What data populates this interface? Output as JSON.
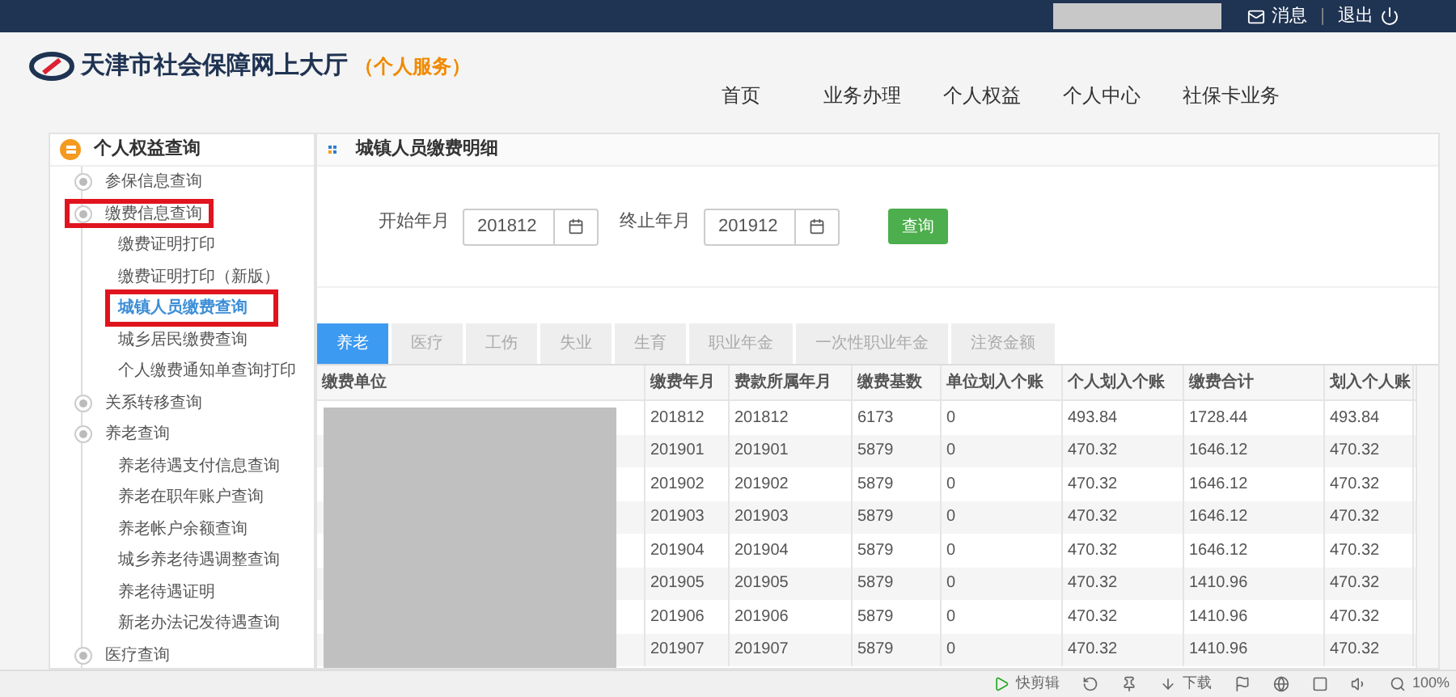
{
  "topbar": {
    "messages": "消息",
    "logout": "退出",
    "separator": "|"
  },
  "header": {
    "site_title": "天津市社会保障网上大厅",
    "site_subtitle": "（个人服务）",
    "nav": [
      {
        "label": "首页"
      },
      {
        "label": "业务办理"
      },
      {
        "label": "个人权益"
      },
      {
        "label": "个人中心"
      },
      {
        "label": "社保卡业务"
      }
    ]
  },
  "sidebar": {
    "title": "个人权益查询",
    "items": [
      {
        "label": "参保信息查询",
        "marked": false
      },
      {
        "label": "缴费信息查询",
        "marked": true,
        "children": [
          {
            "label": "缴费证明打印",
            "selected": false,
            "marked": false
          },
          {
            "label": "缴费证明打印（新版）",
            "selected": false,
            "marked": false
          },
          {
            "label": "城镇人员缴费查询",
            "selected": true,
            "marked": true
          },
          {
            "label": "城乡居民缴费查询",
            "selected": false,
            "marked": false
          },
          {
            "label": "个人缴费通知单查询打印",
            "selected": false,
            "marked": false
          }
        ]
      },
      {
        "label": "关系转移查询",
        "marked": false
      },
      {
        "label": "养老查询",
        "marked": false,
        "children": [
          {
            "label": "养老待遇支付信息查询",
            "selected": false,
            "marked": false
          },
          {
            "label": "养老在职年账户查询",
            "selected": false,
            "marked": false
          },
          {
            "label": "养老帐户余额查询",
            "selected": false,
            "marked": false
          },
          {
            "label": "城乡养老待遇调整查询",
            "selected": false,
            "marked": false
          },
          {
            "label": "养老待遇证明",
            "selected": false,
            "marked": false
          },
          {
            "label": "新老办法记发待遇查询",
            "selected": false,
            "marked": false
          }
        ]
      },
      {
        "label": "医疗查询",
        "marked": false
      }
    ]
  },
  "main": {
    "title": "城镇人员缴费明细",
    "start_label": "开始年月",
    "start_value": "201812",
    "end_label": "终止年月",
    "end_value": "201912",
    "query_button": "查询",
    "tabs": [
      {
        "label": "养老",
        "selected": true
      },
      {
        "label": "医疗",
        "selected": false
      },
      {
        "label": "工伤",
        "selected": false
      },
      {
        "label": "失业",
        "selected": false
      },
      {
        "label": "生育",
        "selected": false
      },
      {
        "label": "职业年金",
        "selected": false
      },
      {
        "label": "一次性职业年金",
        "selected": false
      },
      {
        "label": "注资金额",
        "selected": false
      }
    ],
    "table": {
      "columns": [
        "缴费单位",
        "缴费年月",
        "费款所属年月",
        "缴费基数",
        "单位划入个账",
        "个人划入个账",
        "缴费合计",
        "划入个人账"
      ],
      "unit_redacted": true,
      "rows": [
        [
          "",
          "201812",
          "201812",
          "6173",
          "0",
          "493.84",
          "1728.44",
          "493.84"
        ],
        [
          "",
          "201901",
          "201901",
          "5879",
          "0",
          "470.32",
          "1646.12",
          "470.32"
        ],
        [
          "",
          "201902",
          "201902",
          "5879",
          "0",
          "470.32",
          "1646.12",
          "470.32"
        ],
        [
          "",
          "201903",
          "201903",
          "5879",
          "0",
          "470.32",
          "1646.12",
          "470.32"
        ],
        [
          "",
          "201904",
          "201904",
          "5879",
          "0",
          "470.32",
          "1646.12",
          "470.32"
        ],
        [
          "",
          "201905",
          "201905",
          "5879",
          "0",
          "470.32",
          "1410.96",
          "470.32"
        ],
        [
          "",
          "201906",
          "201906",
          "5879",
          "0",
          "470.32",
          "1410.96",
          "470.32"
        ],
        [
          "",
          "201907",
          "201907",
          "5879",
          "0",
          "470.32",
          "1410.96",
          "470.32"
        ]
      ]
    }
  },
  "status_bar": {
    "clip": "快剪辑",
    "download": "下载",
    "zoom": "100%"
  }
}
